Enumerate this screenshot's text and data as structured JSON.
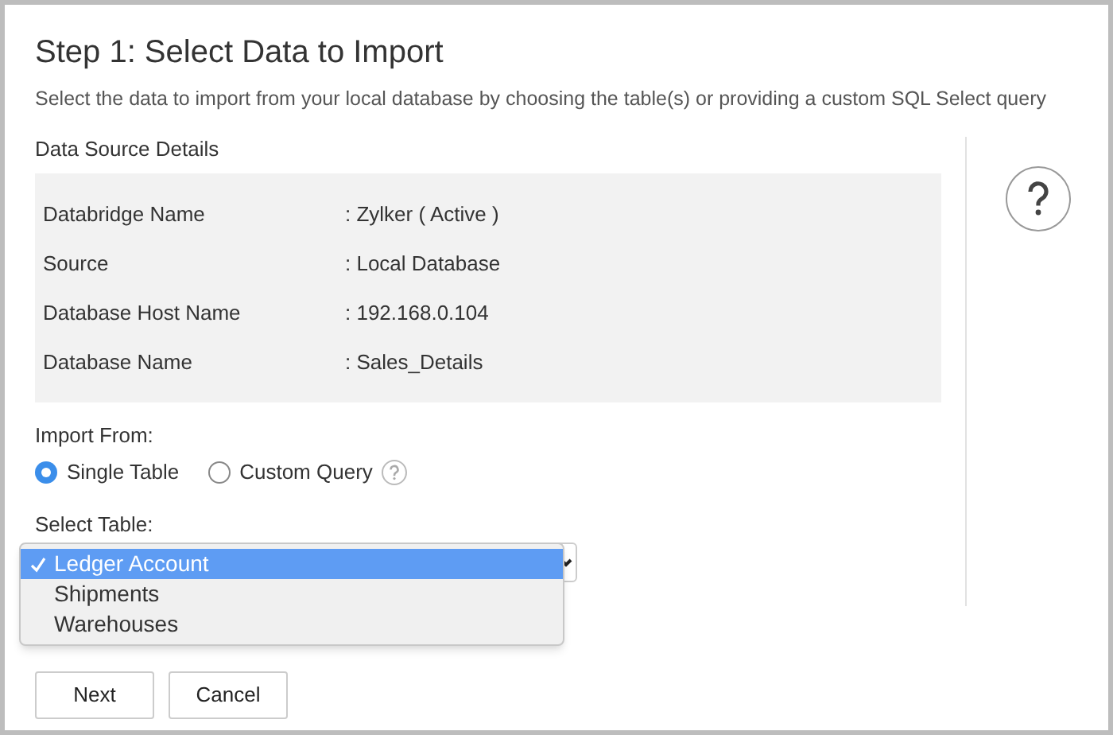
{
  "title": "Step 1: Select Data to Import",
  "description": "Select the data to import from your local database by choosing the table(s) or providing a custom SQL Select query",
  "data_source": {
    "heading": "Data Source Details",
    "rows": [
      {
        "label": "Databridge Name",
        "value": ": Zylker ( Active )"
      },
      {
        "label": "Source",
        "value": ": Local Database"
      },
      {
        "label": "Database Host Name",
        "value": ": 192.168.0.104"
      },
      {
        "label": "Database Name",
        "value": ": Sales_Details"
      }
    ]
  },
  "import_from": {
    "label": "Import From:",
    "options": [
      {
        "label": "Single Table",
        "selected": true,
        "help": false
      },
      {
        "label": "Custom Query",
        "selected": false,
        "help": true
      }
    ]
  },
  "select_table": {
    "label": "Select Table:",
    "options": [
      {
        "label": "Ledger Account",
        "selected": true
      },
      {
        "label": "Shipments",
        "selected": false
      },
      {
        "label": "Warehouses",
        "selected": false
      }
    ]
  },
  "buttons": [
    "Next",
    "Cancel"
  ]
}
